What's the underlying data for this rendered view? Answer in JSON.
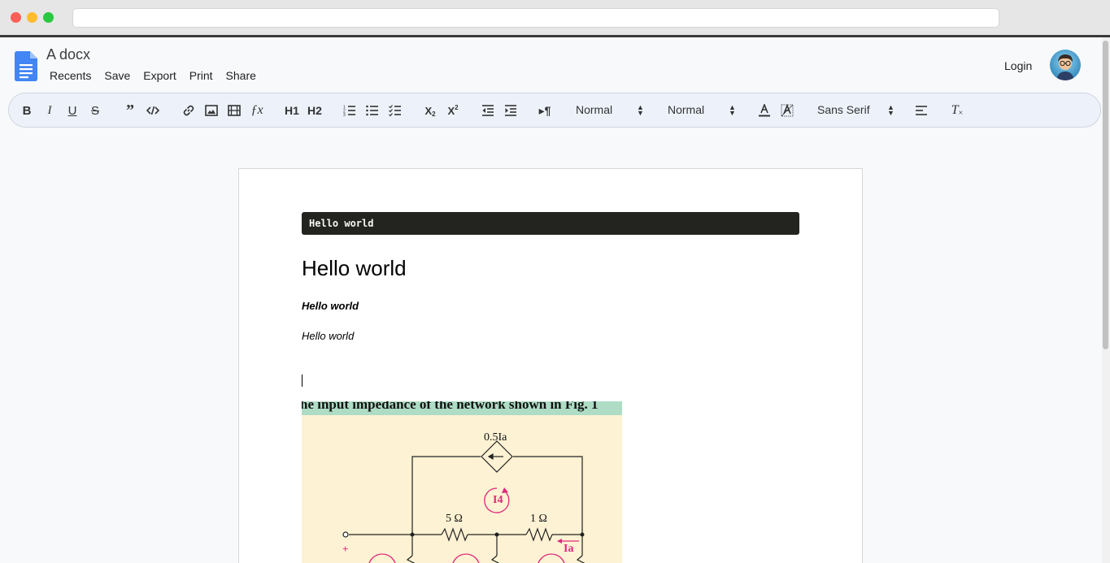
{
  "app": {
    "title": "A docx",
    "menu": [
      "Recents",
      "Save",
      "Export",
      "Print",
      "Share"
    ],
    "login_label": "Login"
  },
  "toolbar": {
    "heading_select": "Normal",
    "size_select": "Normal",
    "font_select": "Sans Serif",
    "h1_label": "H1",
    "h2_label": "H2"
  },
  "document": {
    "code_block": "Hello world",
    "heading": "Hello world",
    "bold_italic": "Hello world",
    "italic": "Hello world",
    "figure": {
      "caption": "he input impedance of the network shown in Fig. 1",
      "source_label": "0.5Ia",
      "loop_current": "I4",
      "r1": "5 Ω",
      "r2": "1 Ω",
      "current_a": "Ia",
      "plus": "+"
    }
  },
  "colors": {
    "brand_blue": "#4285f4",
    "code_bg": "#23241f",
    "figure_bg": "#fdf2d3",
    "figure_banner": "#aedcc5",
    "annotation_pink": "#e0287c"
  }
}
